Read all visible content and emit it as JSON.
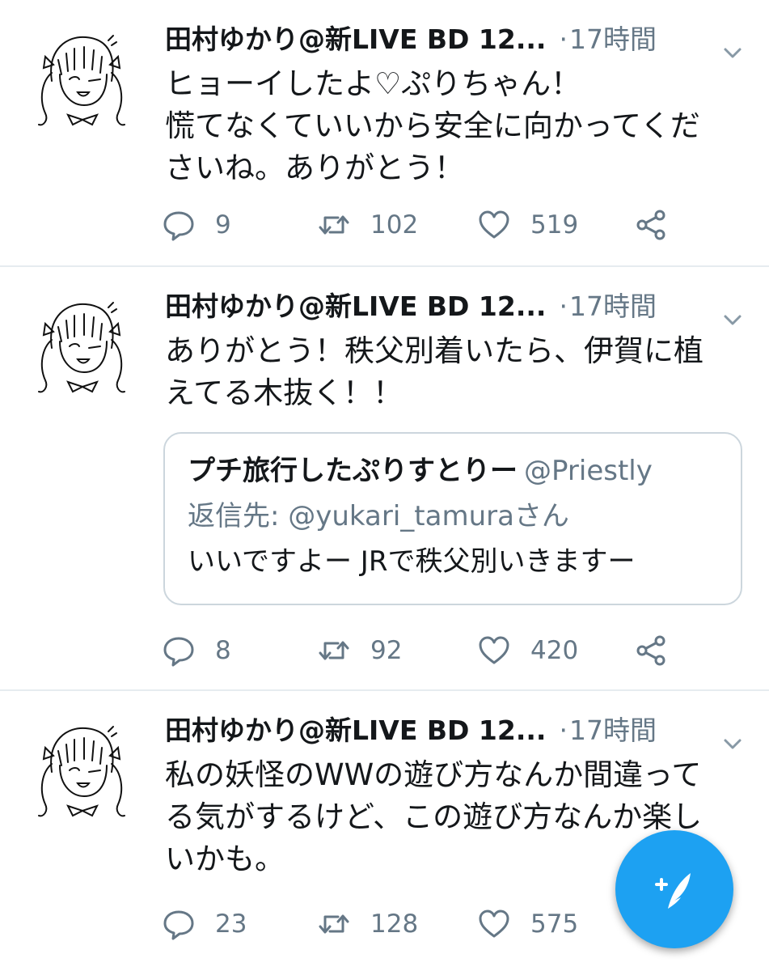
{
  "colors": {
    "accent": "#1da1f2",
    "secondary_text": "#657786",
    "divider": "#e6ecf0"
  },
  "tweets": [
    {
      "author": "田村ゆかり@新LIVE BD 12...",
      "separator": "·",
      "time": "17時間",
      "lines": [
        "ヒョーイしたよ♡ぷりちゃん！",
        "慌てなくていいから安全に向かってくだ",
        "さいね。ありがとう！"
      ],
      "replies": "9",
      "retweets": "102",
      "likes": "519"
    },
    {
      "author": "田村ゆかり@新LIVE BD 12...",
      "separator": "·",
      "time": "17時間",
      "lines": [
        "ありがとう！秩父別着いたら、伊賀に植",
        "えてる木抜く！！"
      ],
      "quote": {
        "name": "プチ旅行したぷりすとりー",
        "handle": "@Priestly",
        "reply_to": "返信先: @yukari_tamuraさん",
        "text": "いいですよー JRで秩父別いきますー"
      },
      "replies": "8",
      "retweets": "92",
      "likes": "420"
    },
    {
      "author": "田村ゆかり@新LIVE BD 12...",
      "separator": "·",
      "time": "17時間",
      "lines": [
        "私の妖怪のWWの遊び方なんか間違って",
        "る気がするけど、この遊び方なんか楽し",
        "いかも。"
      ],
      "replies": "23",
      "retweets": "128",
      "likes": "575"
    }
  ],
  "icons": {
    "reply": "reply-icon",
    "retweet": "retweet-icon",
    "like": "heart-icon",
    "share": "share-icon",
    "menu": "chevron-down-icon",
    "compose": "compose-tweet-icon"
  }
}
